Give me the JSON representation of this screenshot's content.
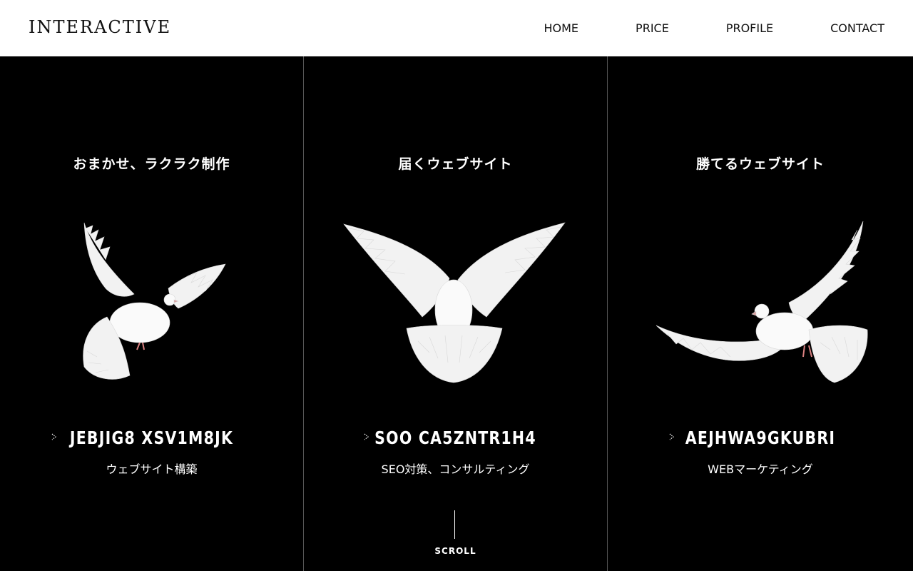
{
  "header": {
    "logo": "INTERACTIVE",
    "nav": [
      "HOME",
      "PRICE",
      "PROFILE",
      "CONTACT"
    ]
  },
  "columns": [
    {
      "heading": "おまかせ、ラクラク制作",
      "code": "JEBJIG8 XSV1M8JK",
      "subtitle": "ウェブサイト構築",
      "icon": "dove-flying-left"
    },
    {
      "heading": "届くウェブサイト",
      "code": "SOO CA5ZNTR1H4",
      "subtitle": "SEO対策、コンサルティング",
      "icon": "dove-spread-wings"
    },
    {
      "heading": "勝てるウェブサイト",
      "code": "AEJHWA9GKUBRI",
      "subtitle": "WEBマーケティング",
      "icon": "dove-flying-right"
    }
  ],
  "scroll": {
    "label": "SCROLL"
  },
  "colors": {
    "header_bg": "#ffffff",
    "main_bg": "#000000",
    "divider": "#555555",
    "text_light": "#ffffff",
    "text_dark": "#111111"
  }
}
